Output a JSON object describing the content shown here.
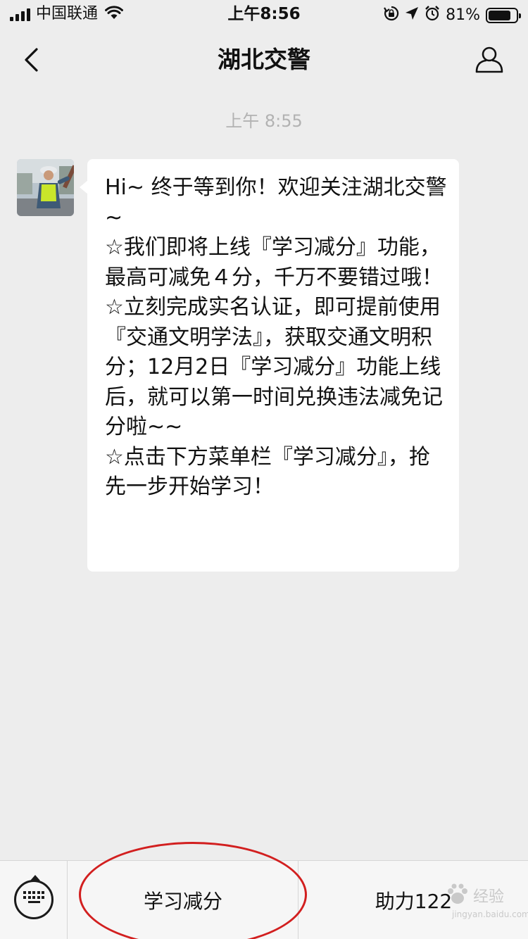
{
  "status_bar": {
    "carrier": "中国联通",
    "time": "上午8:56",
    "battery": "81%",
    "battery_level": 0.81
  },
  "nav": {
    "title": "湖北交警",
    "back_icon": "chevron-left-icon",
    "profile_icon": "person-icon"
  },
  "chat": {
    "timestamp": "上午 8:55",
    "message": {
      "text": "Hi~ 终于等到你！欢迎关注湖北交警 ~\n☆我们即将上线『学习减分』功能，最高可减免４分，千万不要错过哦！\n☆立刻完成实名认证，即可提前使用『交通文明学法』，获取交通文明积分；12月2日『学习减分』功能上线后，就可以第一时间兑换违法减免记分啦~~\n☆点击下方菜单栏『学习减分』，抢先一步开始学习！"
    }
  },
  "menu": {
    "keyboard_icon": "keyboard-icon",
    "items": [
      {
        "label": "学习减分"
      },
      {
        "label": "助力122"
      }
    ]
  },
  "watermark": {
    "text": "经验",
    "sub": "jingyan.baidu.com"
  },
  "colors": {
    "background": "#ededed",
    "bubble": "#ffffff",
    "annotation": "#d21f1f"
  }
}
